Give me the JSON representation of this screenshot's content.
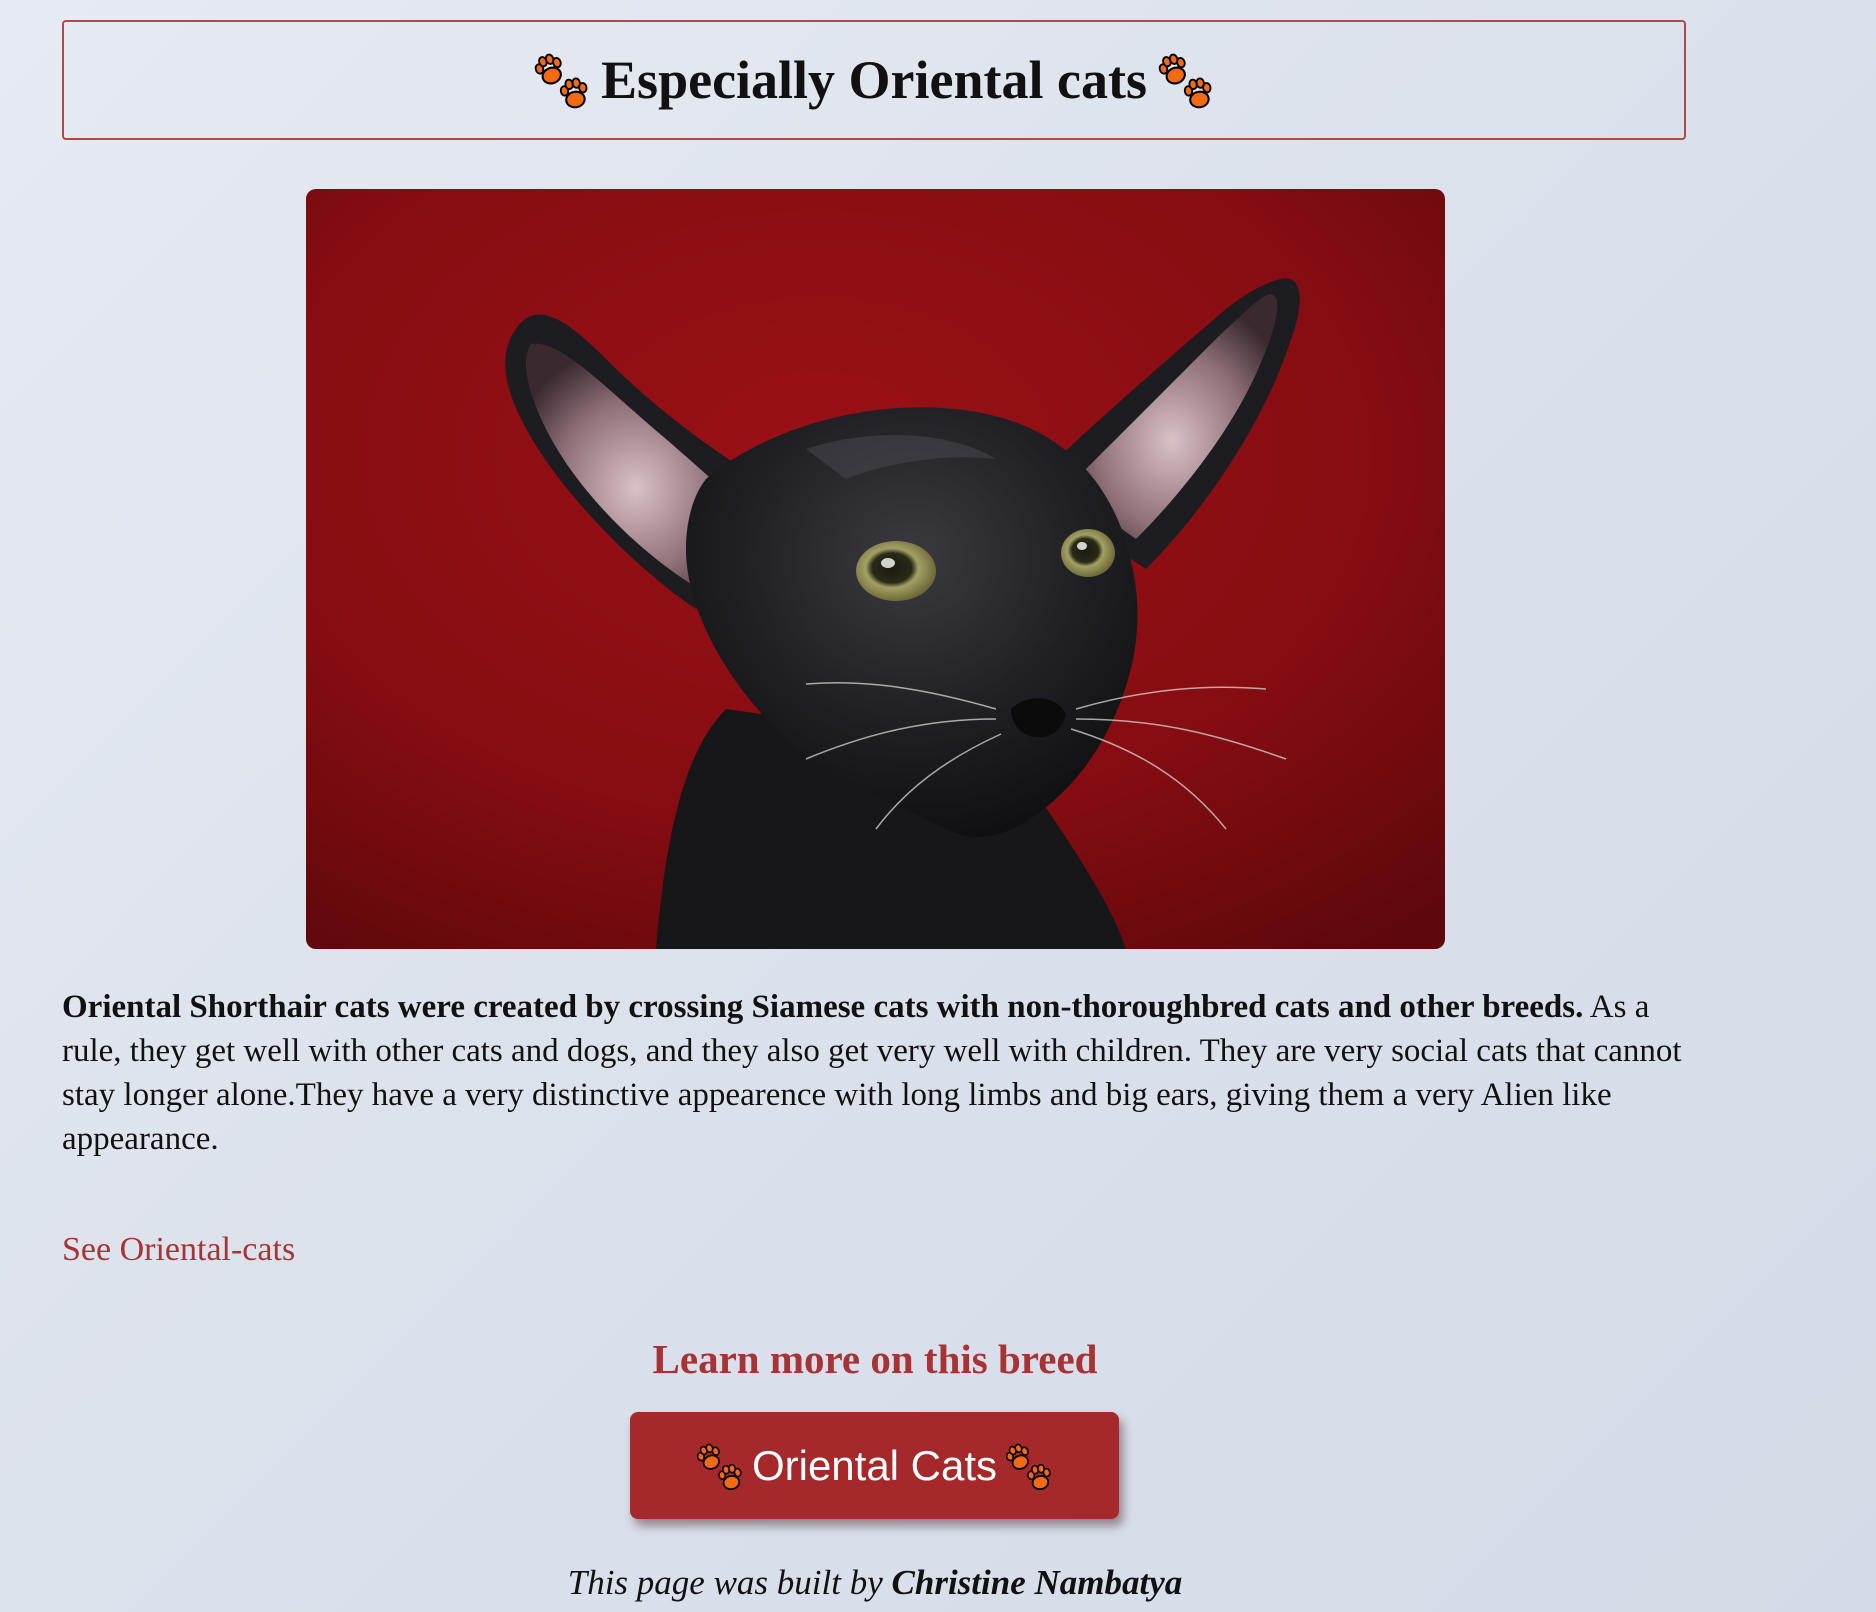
{
  "header": {
    "title": "Especially Oriental cats"
  },
  "hero_image": {
    "alt": "Black Oriental Shorthair cat against red background",
    "background_color": "#8e0f12"
  },
  "description": {
    "bold_text": "Oriental Shorthair cats were created by crossing Siamese cats with non-thoroughbred cats and other breeds.",
    "body_text": " As a rule, they get well with other cats and dogs, and they also get very well with children. They are very social cats that cannot stay longer alone.They have a very distinctive appearence with long limbs and big ears, giving them a very Alien like appearance."
  },
  "link": {
    "label": "See Oriental-cats"
  },
  "learn_more": {
    "heading": "Learn more on this breed",
    "button_label": "Oriental Cats"
  },
  "footer": {
    "prefix": "This page was built by ",
    "author": "Christine Nambatya"
  },
  "colors": {
    "accent": "#a83234",
    "button_bg": "#a5282a",
    "paw": "#f26a12"
  },
  "icons": {
    "paw": "paw-prints-icon"
  }
}
